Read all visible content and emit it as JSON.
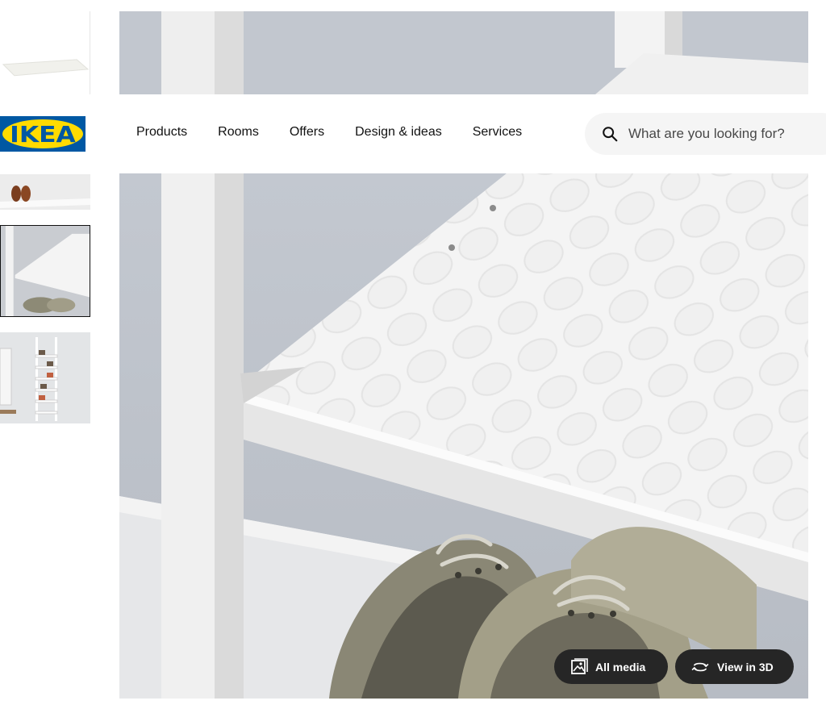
{
  "header": {
    "logo_text": "IKEA",
    "nav": [
      {
        "label": "Products"
      },
      {
        "label": "Rooms"
      },
      {
        "label": "Offers"
      },
      {
        "label": "Design & ideas"
      },
      {
        "label": "Services"
      }
    ],
    "search": {
      "placeholder": "What are you looking for?",
      "icon": "search-icon"
    }
  },
  "gallery": {
    "thumbnails": [
      {
        "name": "shelf-product"
      },
      {
        "name": "shelf-with-shoes"
      },
      {
        "name": "shelf-closeup",
        "selected": true
      },
      {
        "name": "shoe-rack-room"
      }
    ],
    "buttons": {
      "all_media": {
        "label": "All media",
        "icon": "gallery-icon"
      },
      "view_3d": {
        "label": "View in 3D",
        "icon": "rotate-3d-icon"
      }
    }
  },
  "colors": {
    "brand_blue": "#0058a3",
    "brand_yellow": "#ffdb00",
    "button_dark": "#262626"
  }
}
